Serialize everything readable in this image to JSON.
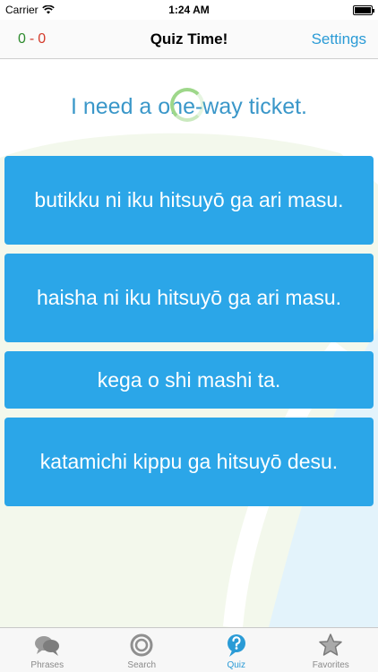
{
  "status_bar": {
    "carrier": "Carrier",
    "time": "1:24 AM"
  },
  "nav": {
    "score_right": "0",
    "score_separator": "-",
    "score_wrong": "0",
    "title": "Quiz Time!",
    "settings_label": "Settings"
  },
  "quiz": {
    "question": "I need a one-way ticket.",
    "answers": [
      "butikku ni iku hitsuyō ga ari masu.",
      "haisha ni iku hitsuyō ga ari masu.",
      "kega o shi mashi ta.",
      "katamichi kippu ga hitsuyō desu."
    ]
  },
  "tabs": [
    {
      "label": "Phrases",
      "icon": "speech-bubbles-icon"
    },
    {
      "label": "Search",
      "icon": "search-icon"
    },
    {
      "label": "Quiz",
      "icon": "quiz-question-icon"
    },
    {
      "label": "Favorites",
      "icon": "star-icon"
    }
  ],
  "active_tab": "Quiz",
  "colors": {
    "accent": "#2a9bd6",
    "answer_button": "#2ba6e8",
    "score_right": "#2e8b2e",
    "score_wrong": "#d43c2c",
    "spinner": "#9ed78a"
  }
}
